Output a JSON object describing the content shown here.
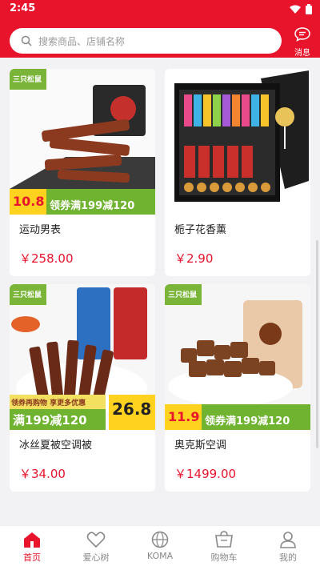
{
  "status_bar": {
    "time": "2:45"
  },
  "search": {
    "placeholder": "搜索商品、店铺名称"
  },
  "messages": {
    "label": "消息"
  },
  "products": [
    {
      "title": "运动男表",
      "price": "￥258.00",
      "badge_price": "10.8",
      "coupon": "领券满199减120",
      "brand": "三只松鼠"
    },
    {
      "title": "栀子花香薰",
      "price": "￥2.90"
    },
    {
      "title": "冰丝夏被空调被",
      "price": "￥34.00",
      "promo_top": "领券再购物 享更多优惠",
      "promo_main": "满199减120",
      "badge_price": "26.8",
      "brand": "三只松鼠"
    },
    {
      "title": "奥克斯空调",
      "price": "￥1499.00",
      "badge_price": "11.9",
      "coupon": "领券满199减120",
      "brand": "三只松鼠"
    }
  ],
  "tabs": [
    {
      "label": "首页",
      "icon": "home-icon",
      "active": true
    },
    {
      "label": "爱心树",
      "icon": "heart-icon"
    },
    {
      "label": "KOMA",
      "icon": "globe-icon"
    },
    {
      "label": "购物车",
      "icon": "cart-icon"
    },
    {
      "label": "我的",
      "icon": "user-icon"
    }
  ],
  "colors": {
    "brand": "#e8142c",
    "coupon_green": "#6fb330",
    "badge_yellow": "#ffd21f"
  }
}
